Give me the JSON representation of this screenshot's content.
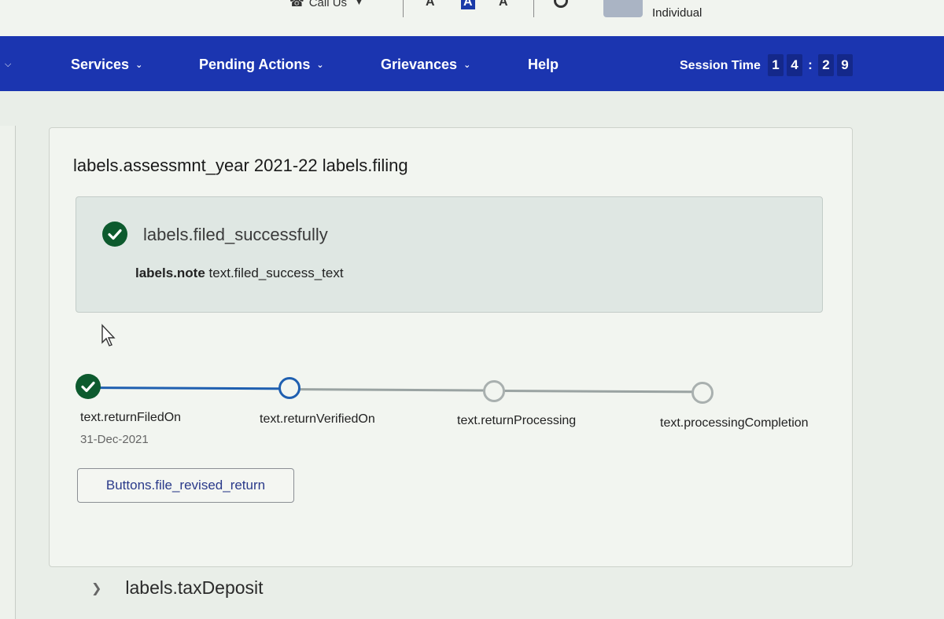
{
  "topbar": {
    "call_us": "Call Us",
    "font_small": "A",
    "font_medium": "A",
    "font_large": "A",
    "user_type": "Individual"
  },
  "nav": {
    "items": [
      {
        "label": "Services",
        "has_dropdown": true
      },
      {
        "label": "Pending Actions",
        "has_dropdown": true
      },
      {
        "label": "Grievances",
        "has_dropdown": true
      },
      {
        "label": "Help",
        "has_dropdown": false
      }
    ],
    "session_label": "Session Time",
    "timer_digits": [
      "1",
      "4",
      ":",
      "2",
      "9"
    ]
  },
  "main": {
    "title": "labels.assessmnt_year 2021-22 labels.filing",
    "success": {
      "title": "labels.filed_successfully",
      "note_label": "labels.note",
      "note_text": "text.filed_success_text"
    },
    "stepper": {
      "steps": [
        {
          "label": "text.returnFiledOn",
          "date": "31-Dec-2021",
          "state": "completed"
        },
        {
          "label": "text.returnVerifiedOn",
          "date": "",
          "state": "current"
        },
        {
          "label": "text.returnProcessing",
          "date": "",
          "state": "pending"
        },
        {
          "label": "text.processingCompletion",
          "date": "",
          "state": "pending"
        }
      ]
    },
    "revise_button": "Buttons.file_revised_return",
    "tax_deposit": "labels.taxDeposit"
  },
  "colors": {
    "nav_bg": "#1b35b0",
    "success_green": "#0d5a2e",
    "step_active": "#1f5fb0"
  }
}
